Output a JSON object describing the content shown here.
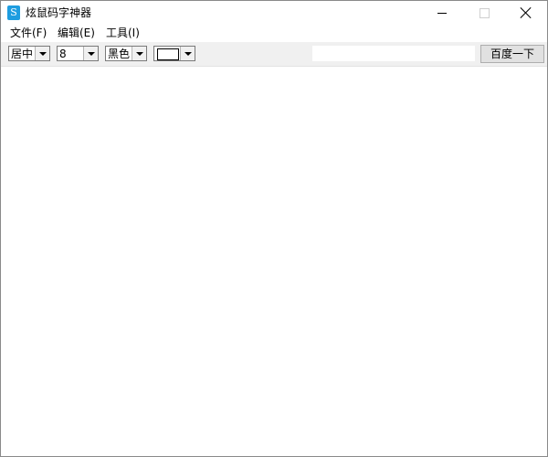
{
  "window": {
    "title": "炫鼠码字神器",
    "icon_letter": "S"
  },
  "menu": {
    "file": "文件(F)",
    "edit": "编辑(E)",
    "tools": "工具(I)"
  },
  "toolbar": {
    "align_value": "居中",
    "size_value": "8",
    "color_value": "黑色",
    "search_value": "",
    "search_button": "百度一下"
  },
  "colors": {
    "app_icon": "#1e9de0",
    "toolbar_bg": "#f0f0f0"
  },
  "icons": {
    "app": "app-logo-icon",
    "minimize": "minimize-icon",
    "maximize": "maximize-icon",
    "close": "close-icon",
    "dropdown": "chevron-down-icon"
  }
}
